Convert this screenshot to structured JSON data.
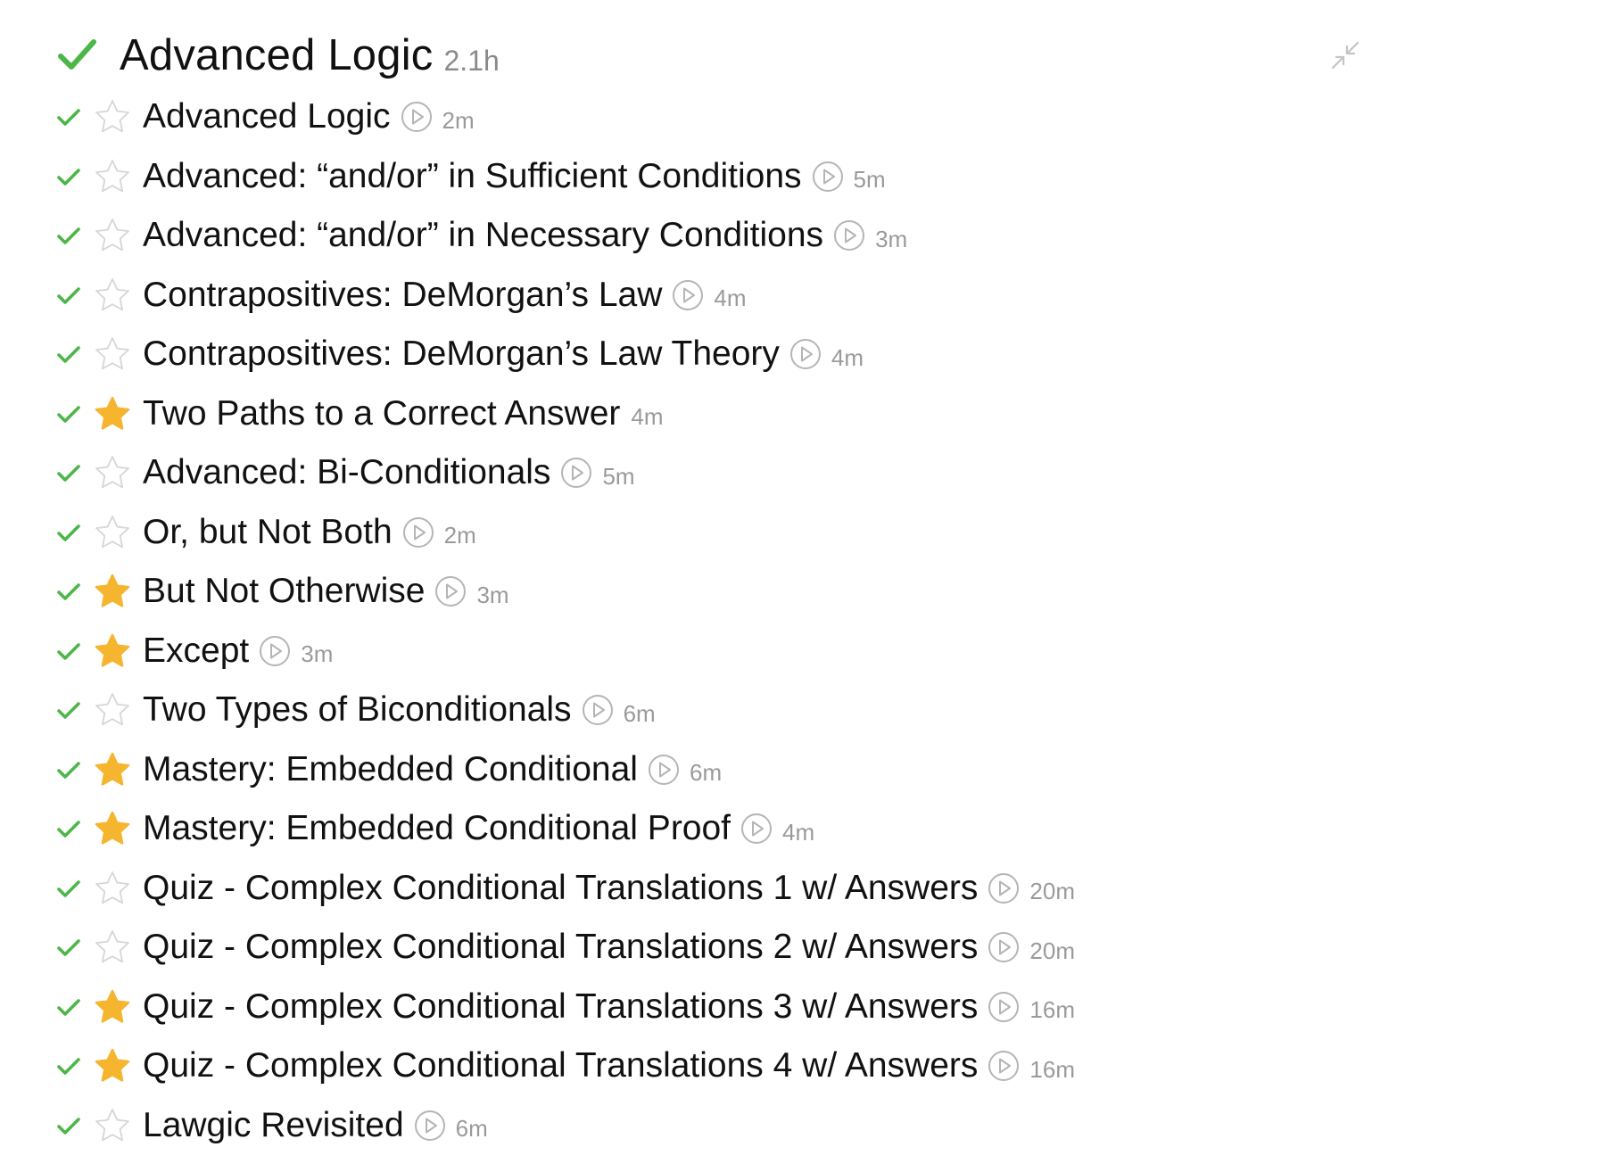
{
  "header": {
    "title": "Advanced Logic",
    "total_time": "2.1h",
    "completed_icon": "check-icon",
    "collapse_icon": "collapse-arrows-icon"
  },
  "colors": {
    "check": "#4cb648",
    "star_filled": "#f5b52f",
    "star_outline": "#d6d6d6",
    "play_outline": "#b5b5b5",
    "collapse_icon": "#c4c4c4",
    "duration_text": "#9a9a9a"
  },
  "lessons": [
    {
      "name": "Advanced Logic",
      "duration": "2m",
      "starred": false,
      "video": true
    },
    {
      "name": "Advanced: “and/or” in Sufficient Conditions",
      "duration": "5m",
      "starred": false,
      "video": true
    },
    {
      "name": "Advanced: “and/or” in Necessary Conditions",
      "duration": "3m",
      "starred": false,
      "video": true
    },
    {
      "name": "Contrapositives: DeMorgan’s Law",
      "duration": "4m",
      "starred": false,
      "video": true
    },
    {
      "name": "Contrapositives: DeMorgan’s Law Theory",
      "duration": "4m",
      "starred": false,
      "video": true
    },
    {
      "name": "Two Paths to a Correct Answer",
      "duration": "4m",
      "starred": true,
      "video": false
    },
    {
      "name": "Advanced: Bi-Conditionals",
      "duration": "5m",
      "starred": false,
      "video": true
    },
    {
      "name": "Or, but Not Both",
      "duration": "2m",
      "starred": false,
      "video": true
    },
    {
      "name": "But Not Otherwise",
      "duration": "3m",
      "starred": true,
      "video": true
    },
    {
      "name": "Except",
      "duration": "3m",
      "starred": true,
      "video": true
    },
    {
      "name": "Two Types of Biconditionals",
      "duration": "6m",
      "starred": false,
      "video": true
    },
    {
      "name": "Mastery: Embedded Conditional",
      "duration": "6m",
      "starred": true,
      "video": true
    },
    {
      "name": "Mastery: Embedded Conditional Proof",
      "duration": "4m",
      "starred": true,
      "video": true
    },
    {
      "name": "Quiz - Complex Conditional Translations 1 w/ Answers",
      "duration": "20m",
      "starred": false,
      "video": true
    },
    {
      "name": "Quiz - Complex Conditional Translations 2 w/ Answers",
      "duration": "20m",
      "starred": false,
      "video": true
    },
    {
      "name": "Quiz - Complex Conditional Translations 3 w/ Answers",
      "duration": "16m",
      "starred": true,
      "video": true
    },
    {
      "name": "Quiz - Complex Conditional Translations 4 w/ Answers",
      "duration": "16m",
      "starred": true,
      "video": true
    },
    {
      "name": "Lawgic Revisited",
      "duration": "6m",
      "starred": false,
      "video": true
    }
  ]
}
